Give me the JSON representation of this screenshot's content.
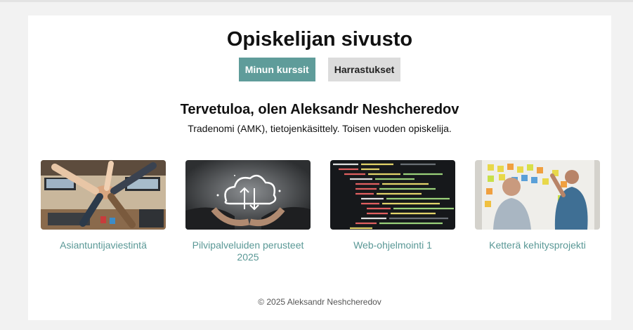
{
  "site": {
    "title": "Opiskelijan sivusto"
  },
  "nav": {
    "items": [
      {
        "label": "Minun kurssit",
        "active": true
      },
      {
        "label": "Harrastukset",
        "active": false
      }
    ]
  },
  "intro": {
    "heading": "Tervetuloa, olen Aleksandr Neshcheredov",
    "subtitle": "Tradenomi (AMK), tietojenkäsittely. Toisen vuoden opiskelija."
  },
  "courses": [
    {
      "name": "Asiantuntijaviestintä",
      "image": "teamwork-hands-photo"
    },
    {
      "name": "Pilvipalveluiden perusteet 2025",
      "image": "cloud-upload-photo"
    },
    {
      "name": "Web-ohjelmointi 1",
      "image": "html-code-photo"
    },
    {
      "name": "Ketterä kehitysprojekti",
      "image": "agile-board-photo"
    }
  ],
  "footer": {
    "text": "© 2025 Aleksandr Neshcheredov"
  },
  "colors": {
    "accent": "#5f9c9a",
    "link": "#5a9896",
    "secondary_button": "#dcdcdc",
    "background": "#f2f2f2"
  }
}
